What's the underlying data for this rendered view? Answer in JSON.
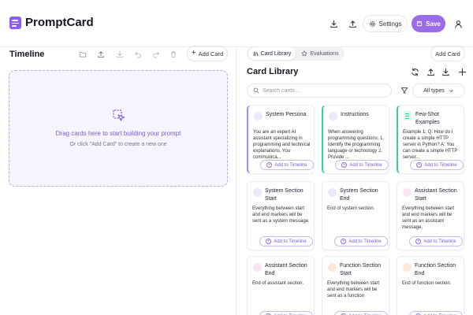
{
  "app": {
    "name": "PromptCard"
  },
  "header": {
    "settings_label": "Settings",
    "save_label": "Save",
    "accent": "#9b6ce8"
  },
  "timeline": {
    "title": "Timeline",
    "add_card_label": "Add Card",
    "drop_main": "Drag cards here to start building your prompt",
    "drop_sub": "Or click \"Add Card\" to create a new one"
  },
  "library": {
    "tabs": [
      {
        "label": "Card Library",
        "icon": "library-icon",
        "active": true
      },
      {
        "label": "Evaluations",
        "icon": "star-icon",
        "active": false
      }
    ],
    "add_card_label": "Add Card",
    "title": "Card Library",
    "search_placeholder": "Search cards...",
    "filter_value": "All types",
    "add_to_timeline_label": "Add to Timeline",
    "cards": [
      {
        "title": "System Persona",
        "desc": "You are an expert AI assistant specializing in programming and technical explanations. You communica...",
        "dot": "#ede7fb",
        "bar": "purple"
      },
      {
        "title": "Instructions",
        "desc": "When answering programming questions: 1. Identify the programming language or technology 2. Provide ...",
        "dot": "#ede7fb",
        "bar": "green"
      },
      {
        "title": "Few-Shot Examples",
        "desc": "Example 1: Q: How do I create a simple HTTP server in Python? A: You can create a simple HTTP server...",
        "dot": "#dff7ec",
        "bar": "green",
        "doc_icon": true
      },
      {
        "title": "System Section Start",
        "desc": "Everything between start and end markers will be sent as a system message.",
        "dot": "#ede7fb"
      },
      {
        "title": "System Section End",
        "desc": "End of system section.",
        "dot": "#ede7fb"
      },
      {
        "title": "Assistant Section Start",
        "desc": "Everything between start and end markers will be sent as an assistant message.",
        "dot": "#fbe4f1"
      },
      {
        "title": "Assistant Section End",
        "desc": "End of assistant section.",
        "dot": "#fbe4f1"
      },
      {
        "title": "Function Section Start",
        "desc": "Everything between start and end markers will be sent as a function",
        "dot": "#fde7d9"
      },
      {
        "title": "Function Section End",
        "desc": "End of function section.",
        "dot": "#fde7d9"
      }
    ]
  }
}
